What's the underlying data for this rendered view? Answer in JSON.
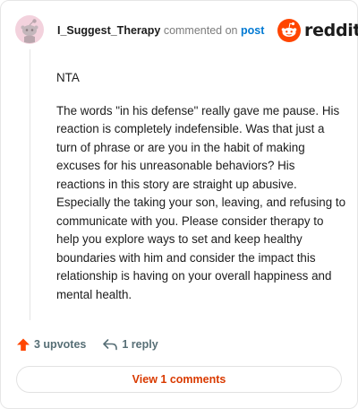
{
  "comment": {
    "author": "I_Suggest_Therapy",
    "action_text": "commented on",
    "target_text": "post",
    "paragraphs": [
      "NTA",
      "The words \"in his defense\" really gave me pause. His reaction is completely indefensible. Was that just a turn of phrase or are you in the habit of making excuses for his unreasonable behaviors? His reactions in this story are straight up abusive. Especially the taking your son, leaving, and refusing to communicate with you. Please consider therapy to help you explore ways to set and keep healthy boundaries with him and consider the impact this relationship is having on your overall happiness and mental health."
    ]
  },
  "brand": {
    "name": "reddit",
    "icon": "reddit-snoo-logo",
    "color": "#ff4500"
  },
  "actions": {
    "upvotes_label": "3 upvotes",
    "replies_label": "1 reply"
  },
  "footer": {
    "view_comments_label": "View 1 comments"
  },
  "icons": {
    "avatar": "snoo-avatar",
    "upvote": "upvote-arrow-icon",
    "reply": "reply-arrow-icon"
  },
  "colors": {
    "upvote": "#ff4500",
    "link": "#0079d3",
    "view_button_text": "#d93a00",
    "avatar_bg": "#f3d2dd"
  }
}
